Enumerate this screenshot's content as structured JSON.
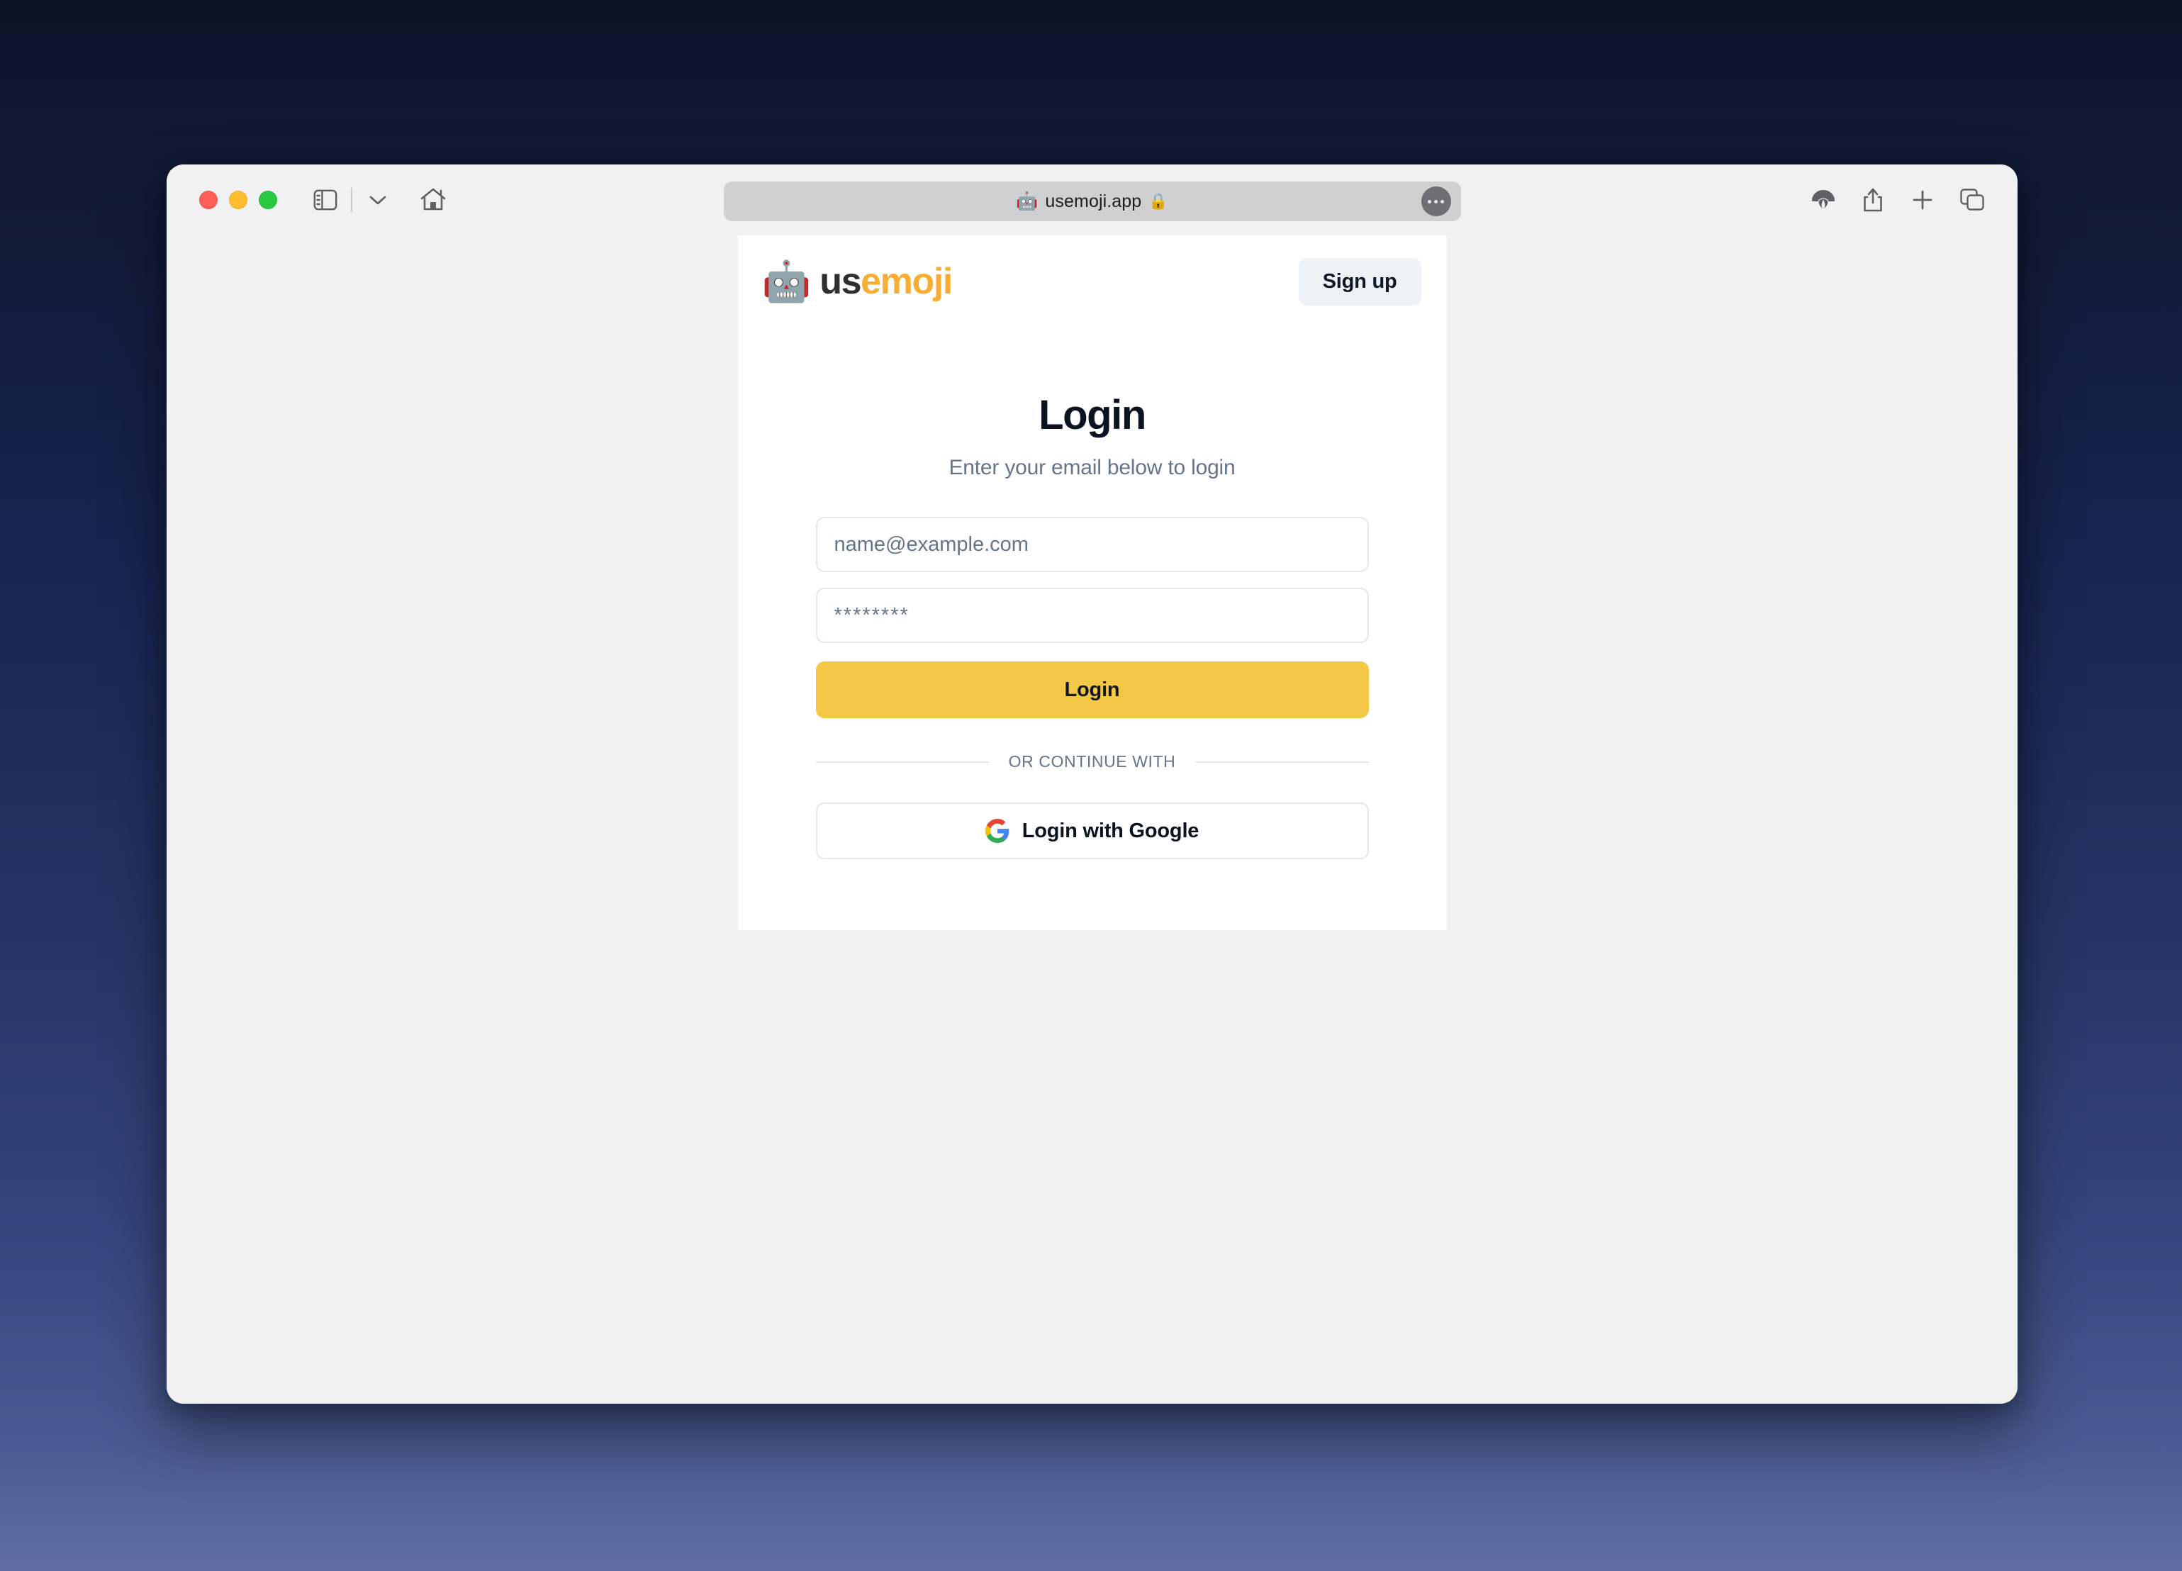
{
  "desktop": {
    "gradient_top": "#0d1429",
    "gradient_bottom": "#5f6fa4"
  },
  "browser": {
    "window_controls": {
      "close_label": "close",
      "minimize_label": "minimize",
      "maximize_label": "maximize"
    },
    "toolbar": {
      "sidebar_icon": "sidebar-icon",
      "sidebar_menu_icon": "chevron-down-icon",
      "home_icon": "home-icon",
      "extensions_icon": "safari-extensions-icon",
      "share_icon": "share-icon",
      "new_tab_icon": "plus-icon",
      "tab_overview_icon": "tab-overview-icon"
    },
    "address_bar": {
      "favicon": "🤖",
      "url": "usemoji.app",
      "lock": "🔒",
      "more_icon": "ellipsis-icon"
    }
  },
  "page": {
    "background": "#f1f1f1",
    "card_background": "#ffffff",
    "header": {
      "brand_mark": "🤖",
      "brand_name_primary": "us",
      "brand_name_accent": "emoji",
      "brand_primary_color": "#2f2f2f",
      "brand_accent_color": "#f9ae32",
      "signup_label": "Sign up"
    },
    "login": {
      "title": "Login",
      "subtitle": "Enter your email below to login",
      "email_placeholder": "name@example.com",
      "email_value": "",
      "password_value": "********",
      "password_placeholder": "",
      "submit_label": "Login",
      "submit_color": "#f4c847",
      "divider_label": "OR CONTINUE WITH",
      "google_label": "Login with Google",
      "google_icon": "google-g-icon"
    }
  }
}
